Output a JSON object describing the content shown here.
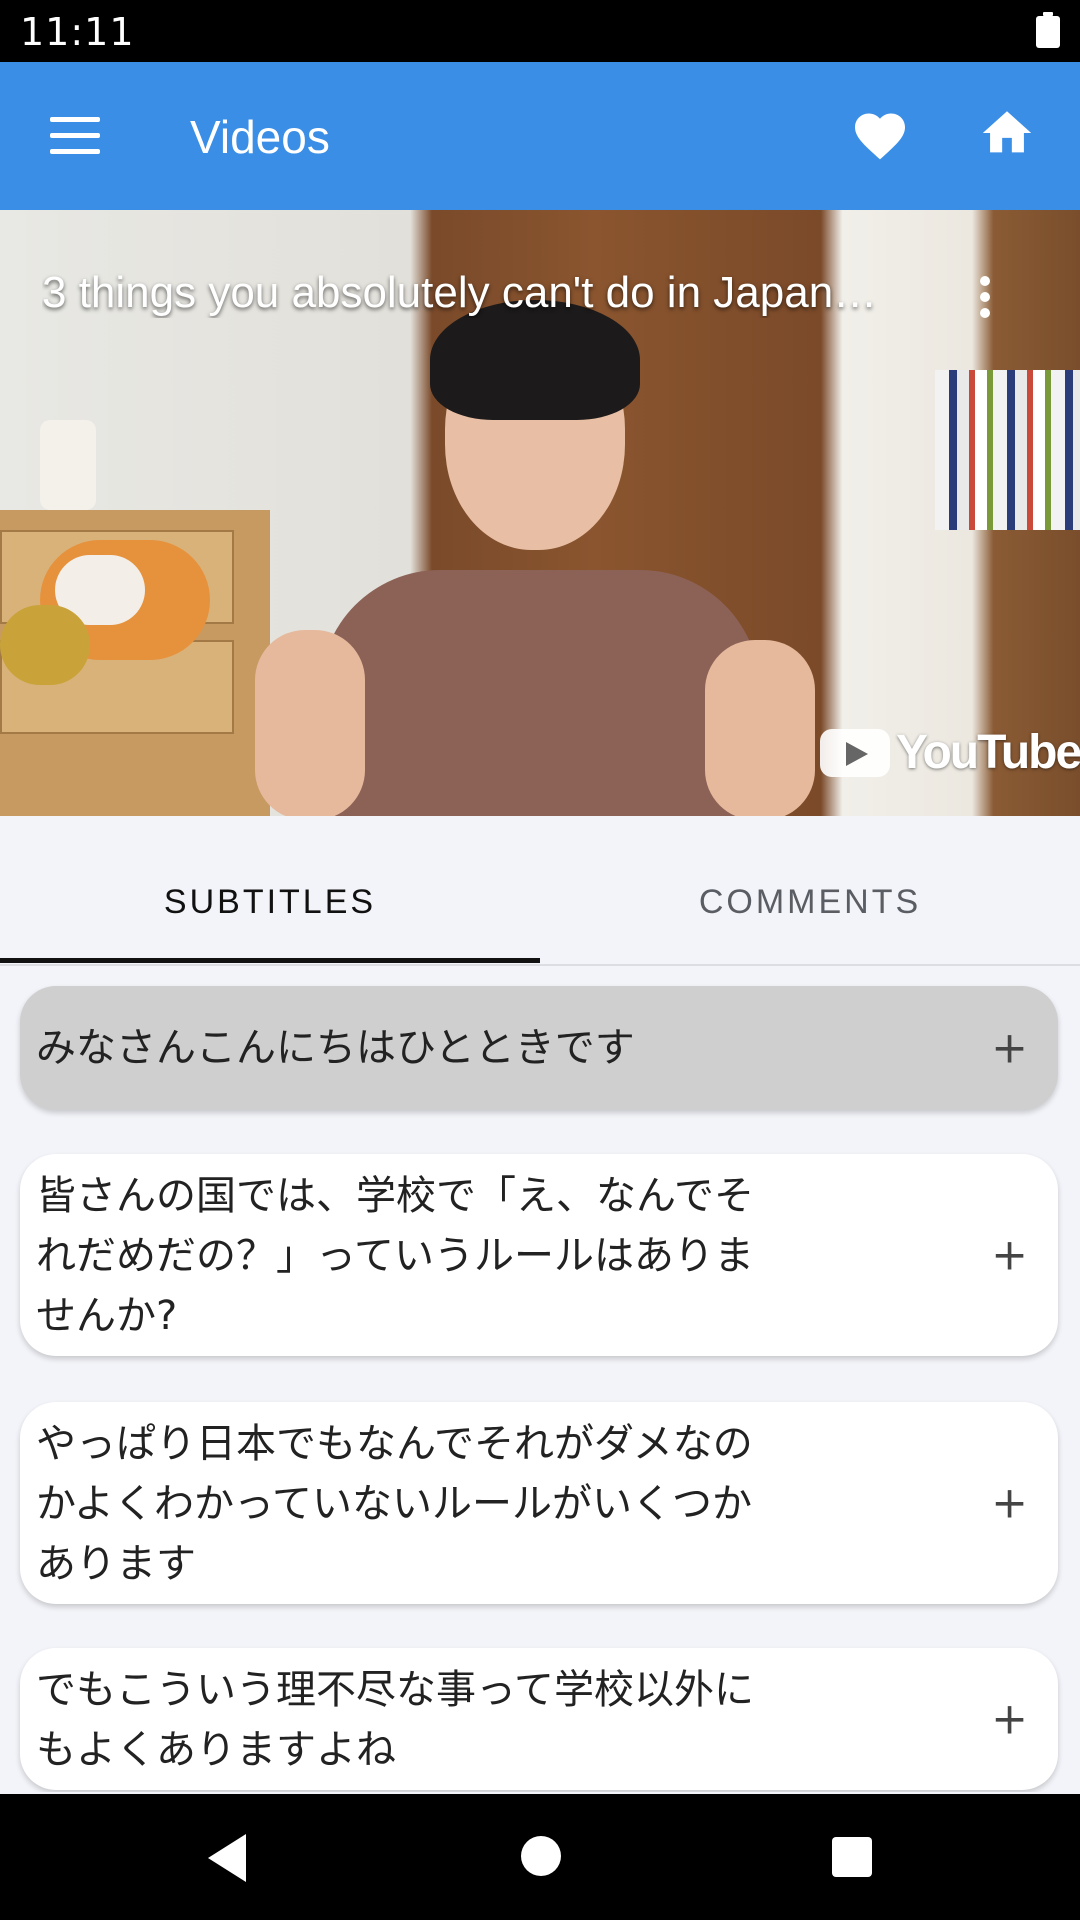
{
  "status_bar": {
    "time": "11:11"
  },
  "app_bar": {
    "title": "Videos"
  },
  "video": {
    "title": "3 things you absolutely can't do in Japan…",
    "brand": "YouTube"
  },
  "tabs": [
    {
      "label": "SUBTITLES",
      "selected": true
    },
    {
      "label": "COMMENTS",
      "selected": false
    }
  ],
  "subtitles": [
    {
      "text": "みなさんこんにちはひとときです",
      "active": true,
      "action": "+"
    },
    {
      "text": "皆さんの国では、学校で「え、なんでそれだめだの？」っていうルールはありませんか?",
      "active": false,
      "action": "+"
    },
    {
      "text": "やっぱり日本でもなんでそれがダメなのかよくわかっていないルールがいくつかあります",
      "active": false,
      "action": "+"
    },
    {
      "text": "でもこういう理不尽な事って学校以外にもよくありますよね",
      "active": false,
      "action": "+"
    }
  ],
  "colors": {
    "app_bar": "#3a8ee6",
    "active_card": "#cfcfcf",
    "background": "#f3f4f9"
  },
  "icons": [
    "menu-icon",
    "heart-icon",
    "home-icon",
    "more-vert-icon",
    "youtube-logo",
    "plus-icon",
    "back-icon",
    "home-circle-icon",
    "recents-icon"
  ]
}
